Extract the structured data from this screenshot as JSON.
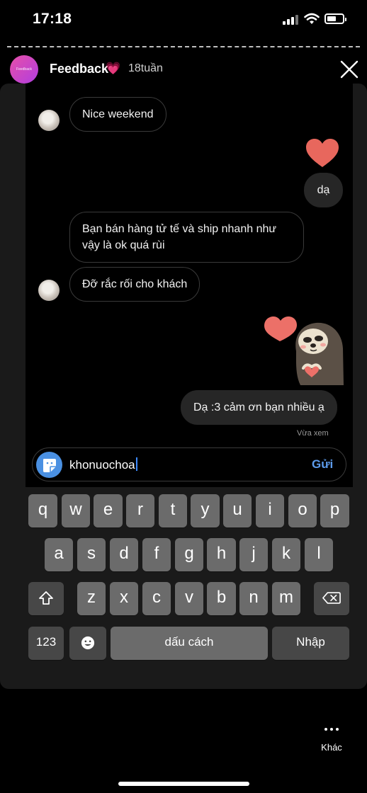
{
  "status_bar": {
    "time": "17:18"
  },
  "header": {
    "avatar_text": "Feedback",
    "title": "Feedback",
    "title_emoji": "💗",
    "time_ago": "18tuần",
    "close_icon": "close-icon"
  },
  "messages": [
    {
      "id": "m1",
      "sender": "other",
      "text": "Nice weekend"
    },
    {
      "id": "m2",
      "sender": "me",
      "reaction_icon": "heart-icon",
      "text": "dạ"
    },
    {
      "id": "m3",
      "sender": "other",
      "text": "Bạn bán hàng tử tế và ship nhanh như vậy là ok quá rùi"
    },
    {
      "id": "m4",
      "sender": "other",
      "text": "Đỡ rắc rối cho khách"
    },
    {
      "id": "m5",
      "sender": "me",
      "sticker_icon": "sloth-heart-sticker"
    },
    {
      "id": "m6",
      "sender": "me",
      "text": "Dạ :3 cảm ơn bạn nhiều ạ"
    }
  ],
  "seen_status": "Vừa xem",
  "composer": {
    "value": "khonuochoa",
    "send_label": "Gửi",
    "sticker_icon": "sticker-icon"
  },
  "keyboard": {
    "row1": [
      "q",
      "w",
      "e",
      "r",
      "t",
      "y",
      "u",
      "i",
      "o",
      "p"
    ],
    "row2": [
      "a",
      "s",
      "d",
      "f",
      "g",
      "h",
      "j",
      "k",
      "l"
    ],
    "row3": [
      "z",
      "x",
      "c",
      "v",
      "b",
      "n",
      "m"
    ],
    "numbers_label": "123",
    "emoji_icon": "emoji-icon",
    "space_label": "dấu cách",
    "return_label": "Nhập",
    "shift_icon": "shift-icon",
    "backspace_icon": "backspace-icon"
  },
  "more": {
    "label": "Khác",
    "icon": "more-dots-icon"
  },
  "colors": {
    "accent": "#5d9cec",
    "avatar_gradient_start": "#e74fa8",
    "avatar_gradient_end": "#b13ee0"
  }
}
